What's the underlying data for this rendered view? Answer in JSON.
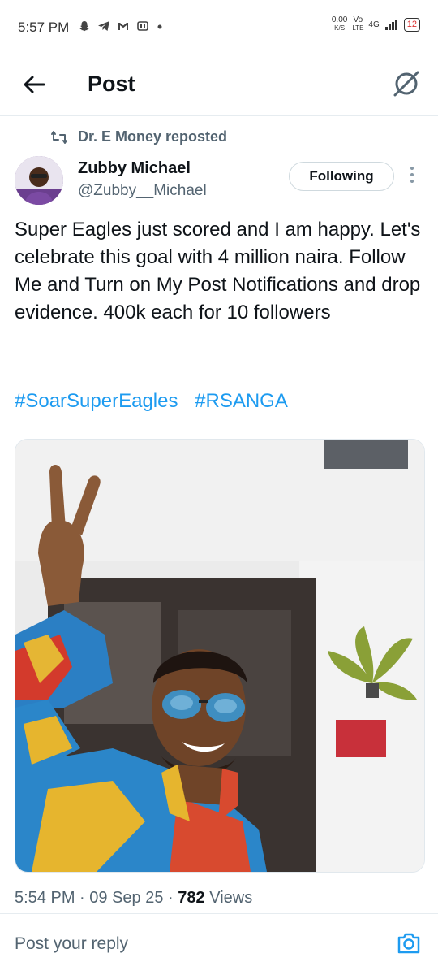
{
  "status_bar": {
    "time": "5:57 PM",
    "net_speed_value": "0.00",
    "net_speed_unit": "K/S",
    "net_label_top": "Vo",
    "net_label_bottom": "LTE",
    "network": "4G",
    "battery": "12"
  },
  "header": {
    "title": "Post"
  },
  "repost": {
    "text": "Dr. E Money reposted"
  },
  "author": {
    "name": "Zubby Michael",
    "handle": "@Zubby__Michael",
    "follow_label": "Following"
  },
  "tweet": {
    "text": "Super Eagles just scored and I am happy. Let's celebrate this goal with 4 million naira. Follow Me and Turn on My Post Notifications and drop evidence.  400k each for 10 followers",
    "hashtags": [
      "#SoarSuperEagles",
      "#RSANGA"
    ]
  },
  "meta": {
    "time": "5:54 PM",
    "date": "09 Sep 25",
    "views_count": "782",
    "views_label": "Views",
    "sep": "·"
  },
  "reply": {
    "placeholder": "Post your reply"
  },
  "colors": {
    "accent": "#1d9bf0",
    "text": "#0f1419",
    "muted": "#536471"
  },
  "icons": [
    "back-arrow-icon",
    "grok-icon",
    "repost-icon",
    "more-icon",
    "camera-icon"
  ]
}
